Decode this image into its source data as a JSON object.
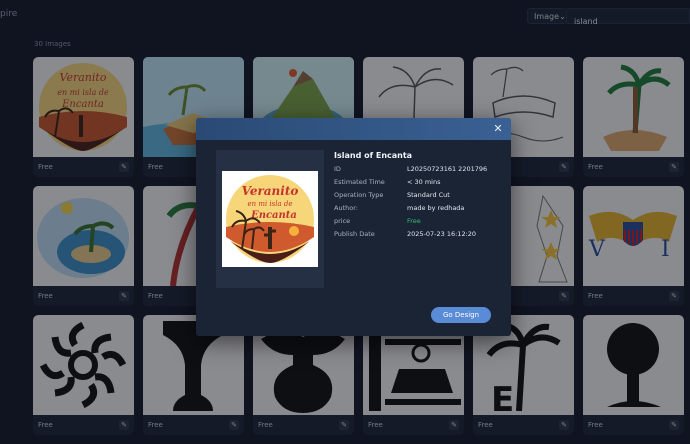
{
  "header": {
    "brand": "pire",
    "type_select": "Image",
    "search_value": "island"
  },
  "results": {
    "count_label": "30 Images"
  },
  "card_price": "Free",
  "modal": {
    "title": "Island of Encanta",
    "fields": [
      {
        "label": "ID",
        "value": "L20250723161 2201796"
      },
      {
        "label": "Estimated Time",
        "value": "< 30 mins"
      },
      {
        "label": "Operation Type",
        "value": "Standard Cut"
      },
      {
        "label": "Author:",
        "value": "made by redhada"
      },
      {
        "label": "price",
        "value": "Free"
      },
      {
        "label": "Publish Date",
        "value": "2025-07-23 16:12:20"
      }
    ],
    "button": "Go Design",
    "artwork_text": [
      "Veranito",
      "en mi isla de",
      "Encanta"
    ]
  },
  "colors": {
    "accent": "#5a8bd6",
    "free": "#2fbf71",
    "background": "#141b2a"
  }
}
